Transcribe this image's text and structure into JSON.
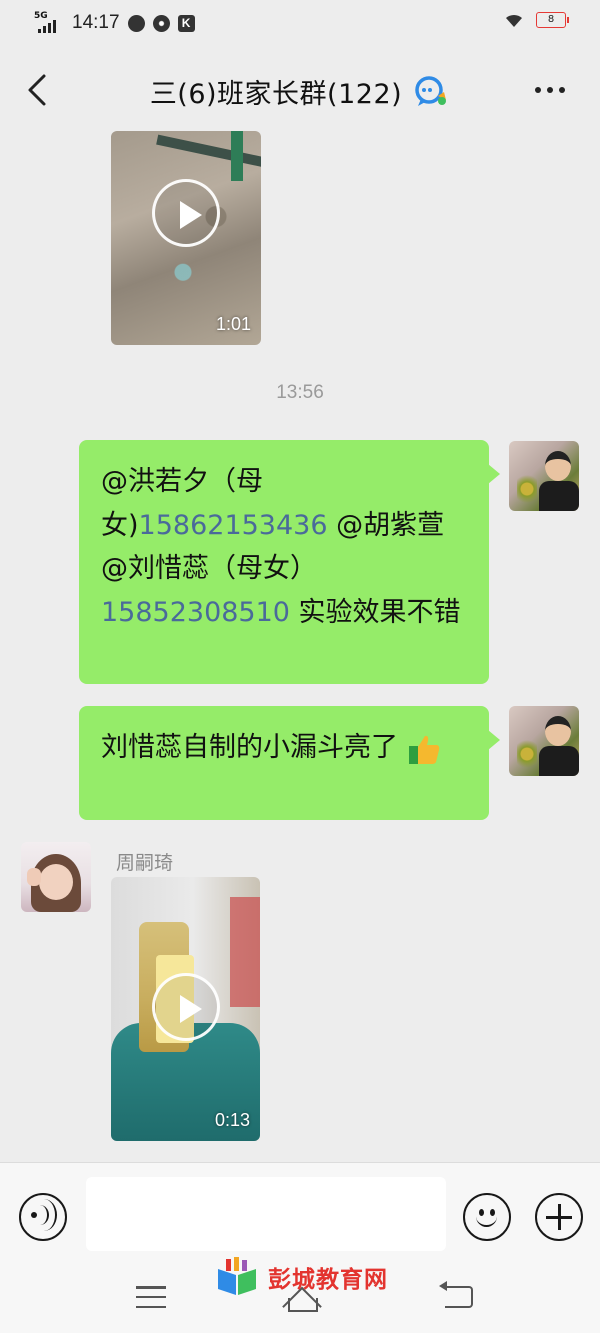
{
  "status_bar": {
    "network": "5G",
    "time": "14:17",
    "app_icons": [
      "compass-icon",
      "fan-icon",
      "k-app-icon"
    ],
    "k_label": "K",
    "battery": "8"
  },
  "header": {
    "title": "三(6)班家长群(122)",
    "back_icon": "chevron-left-icon",
    "more_icon": "more-dots-icon"
  },
  "messages": {
    "video1": {
      "duration": "1:01"
    },
    "timestamp": "13:56",
    "msg1": {
      "text_a": "@洪若夕（母女)",
      "phone_a": "15862153436",
      "text_b": " @胡紫萱 @刘惜蕊（母女）",
      "phone_b": "15852308510",
      "text_c": " 实验效果不错"
    },
    "msg2": {
      "text": "刘惜蕊自制的小漏斗亮了",
      "emoji": "thumbs-up-icon"
    },
    "friend": {
      "sender": "周嗣琦",
      "video_duration": "0:13"
    }
  },
  "input_bar": {
    "placeholder": "",
    "voice_icon": "voice-icon",
    "emoji_icon": "emoji-icon",
    "plus_icon": "plus-icon"
  },
  "watermark": {
    "text": "彭城教育网"
  },
  "colors": {
    "bubble_green": "#95ec69",
    "background": "#ededed",
    "phone_link": "#4a6a9a",
    "watermark_red": "#e3342f"
  }
}
